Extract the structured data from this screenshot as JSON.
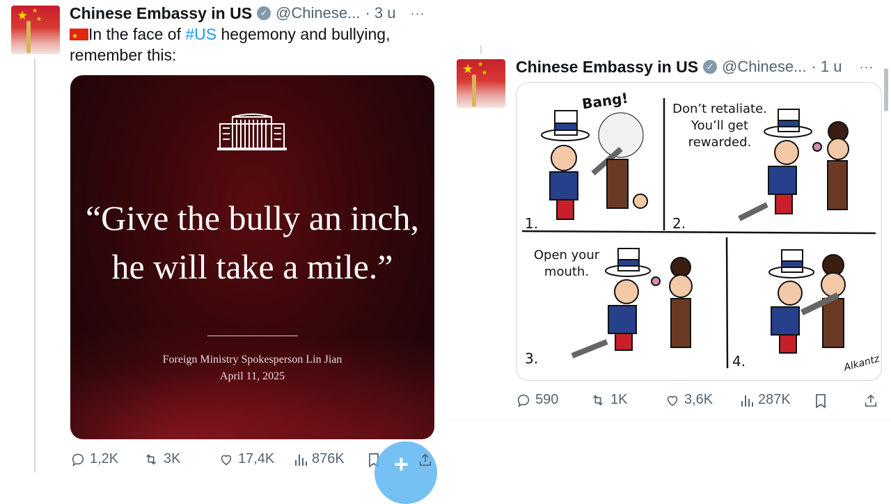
{
  "left_tweet": {
    "author_name": "Chinese Embassy in US",
    "handle": "@Chinese...",
    "time": "· 3 u",
    "text_prefix": "In the face of ",
    "hashtag": "#US",
    "text_suffix": " hegemony and bullying,",
    "text_line2": "remember this:",
    "card": {
      "quote_line1": "“Give the bully an inch,",
      "quote_line2": "he will take a mile.”",
      "attribution_line1": "Foreign Ministry Spokesperson Lin Jian",
      "attribution_line2": "April 11, 2025"
    },
    "actions": {
      "replies": "1,2K",
      "reposts": "3K",
      "likes": "17,4K",
      "views": "876K"
    }
  },
  "right_tweet": {
    "author_name": "Chinese Embassy in US",
    "handle": "@Chinese...",
    "time": "· 1 u",
    "comic": {
      "panel1_sfx": "Bang!",
      "panel1_number": "1.",
      "panel2_speech": [
        "Don’t retaliate.",
        "You’ll get",
        "rewarded."
      ],
      "panel2_number": "2.",
      "panel3_speech": [
        "Open your",
        "mouth."
      ],
      "panel3_number": "3.",
      "panel4_number": "4.",
      "signature": "Alkantz"
    },
    "actions": {
      "replies": "590",
      "reposts": "1K",
      "likes": "3,6K",
      "views": "287K"
    }
  },
  "colors": {
    "link": "#1d9bf0",
    "muted": "#536471",
    "card_bg": "#3a070b"
  }
}
